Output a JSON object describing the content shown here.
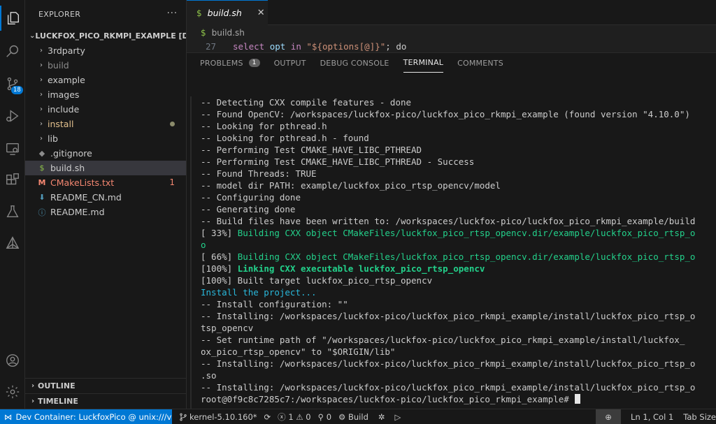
{
  "activity_bar": {
    "items": [
      {
        "name": "explorer-icon",
        "active": true
      },
      {
        "name": "search-icon"
      },
      {
        "name": "source-control-icon",
        "badge": "18"
      },
      {
        "name": "run-debug-icon"
      },
      {
        "name": "remote-explorer-icon"
      },
      {
        "name": "extensions-icon"
      },
      {
        "name": "testing-icon"
      },
      {
        "name": "cmake-icon"
      }
    ],
    "bottom": [
      {
        "name": "account-icon"
      },
      {
        "name": "settings-gear-icon"
      }
    ]
  },
  "sidebar": {
    "title": "EXPLORER",
    "more": "···",
    "project": "LUCKFOX_PICO_RKMPI_EXAMPLE [DEV ...",
    "items": [
      {
        "label": "3rdparty",
        "type": "folder"
      },
      {
        "label": "build",
        "type": "folder",
        "dim": true
      },
      {
        "label": "example",
        "type": "folder"
      },
      {
        "label": "images",
        "type": "folder"
      },
      {
        "label": "include",
        "type": "folder"
      },
      {
        "label": "install",
        "type": "folder",
        "modified": true
      },
      {
        "label": "lib",
        "type": "folder"
      },
      {
        "label": ".gitignore",
        "type": "file",
        "icon": "gitignore-icon"
      },
      {
        "label": "build.sh",
        "type": "file",
        "icon": "shell-icon",
        "selected": true
      },
      {
        "label": "CMakeLists.txt",
        "type": "file",
        "icon": "cmake-file-icon",
        "errors": "1"
      },
      {
        "label": "README_CN.md",
        "type": "file",
        "icon": "markdown-icon"
      },
      {
        "label": "README.md",
        "type": "file",
        "icon": "info-icon"
      }
    ],
    "outline": "OUTLINE",
    "timeline": "TIMELINE"
  },
  "editor": {
    "tab": {
      "label": "build.sh",
      "close": "✕"
    },
    "breadcrumb": "build.sh",
    "code_line": {
      "number": "27",
      "kw1": "select",
      "var": "opt",
      "kw2": "in",
      "str": "\"${options[@]}\"",
      "tail": "; do"
    }
  },
  "panel": {
    "tabs": [
      {
        "label": "PROBLEMS",
        "badge": "1"
      },
      {
        "label": "OUTPUT"
      },
      {
        "label": "DEBUG CONSOLE"
      },
      {
        "label": "TERMINAL",
        "active": true
      },
      {
        "label": "COMMENTS"
      }
    ],
    "terminal_lines": [
      {
        "text": "-- Detecting CXX compile features - done"
      },
      {
        "text": "-- Found OpenCV: /workspaces/luckfox-pico/luckfox_pico_rkmpi_example (found version \"4.10.0\")"
      },
      {
        "text": "-- Looking for pthread.h"
      },
      {
        "text": "-- Looking for pthread.h - found"
      },
      {
        "text": "-- Performing Test CMAKE_HAVE_LIBC_PTHREAD"
      },
      {
        "text": "-- Performing Test CMAKE_HAVE_LIBC_PTHREAD - Success"
      },
      {
        "text": "-- Found Threads: TRUE"
      },
      {
        "text": "-- model dir PATH: example/luckfox_pico_rtsp_opencv/model"
      },
      {
        "text": "-- Configuring done"
      },
      {
        "text": "-- Generating done"
      },
      {
        "text": "-- Build files have been written to: /workspaces/luckfox-pico/luckfox_pico_rkmpi_example/build"
      },
      {
        "prefix": "[ 33%] ",
        "text": "Building CXX object CMakeFiles/luckfox_pico_rtsp_opencv.dir/example/luckfox_pico_rtsp_o",
        "style": "green"
      },
      {
        "text": "o",
        "style": "green"
      },
      {
        "prefix": "[ 66%] ",
        "text": "Building CXX object CMakeFiles/luckfox_pico_rtsp_opencv.dir/example/luckfox_pico_rtsp_o",
        "style": "green"
      },
      {
        "prefix": "[100%] ",
        "text": "Linking CXX executable luckfox_pico_rtsp_opencv",
        "style": "bold"
      },
      {
        "text": "[100%] Built target luckfox_pico_rtsp_opencv"
      },
      {
        "text": "Install the project...",
        "style": "cyan"
      },
      {
        "text": "-- Install configuration: \"\""
      },
      {
        "text": "-- Installing: /workspaces/luckfox-pico/luckfox_pico_rkmpi_example/install/luckfox_pico_rtsp_o"
      },
      {
        "text": "tsp_opencv"
      },
      {
        "text": "-- Set runtime path of \"/workspaces/luckfox-pico/luckfox_pico_rkmpi_example/install/luckfox_"
      },
      {
        "text": "ox_pico_rtsp_opencv\" to \"$ORIGIN/lib\""
      },
      {
        "text": "-- Installing: /workspaces/luckfox-pico/luckfox_pico_rkmpi_example/install/luckfox_pico_rtsp_o"
      },
      {
        "text": ".so"
      },
      {
        "text": "-- Installing: /workspaces/luckfox-pico/luckfox_pico_rkmpi_example/install/luckfox_pico_rtsp_o"
      }
    ],
    "prompt": "root@0f9c8c7285c7:/workspaces/luckfox-pico/luckfox_pico_rkmpi_example#"
  },
  "status_bar": {
    "remote": "Dev Container: LuckfoxPico @ unix:///var...",
    "branch": "kernel-5.10.160*",
    "errors": "1",
    "warnings": "0",
    "ports": "0",
    "build": "Build",
    "position": "Ln 1, Col 1",
    "tab_size": "Tab Size"
  },
  "colors": {
    "accent": "#0078d4",
    "terminal_green": "#23d18b",
    "terminal_cyan": "#29b8db"
  }
}
